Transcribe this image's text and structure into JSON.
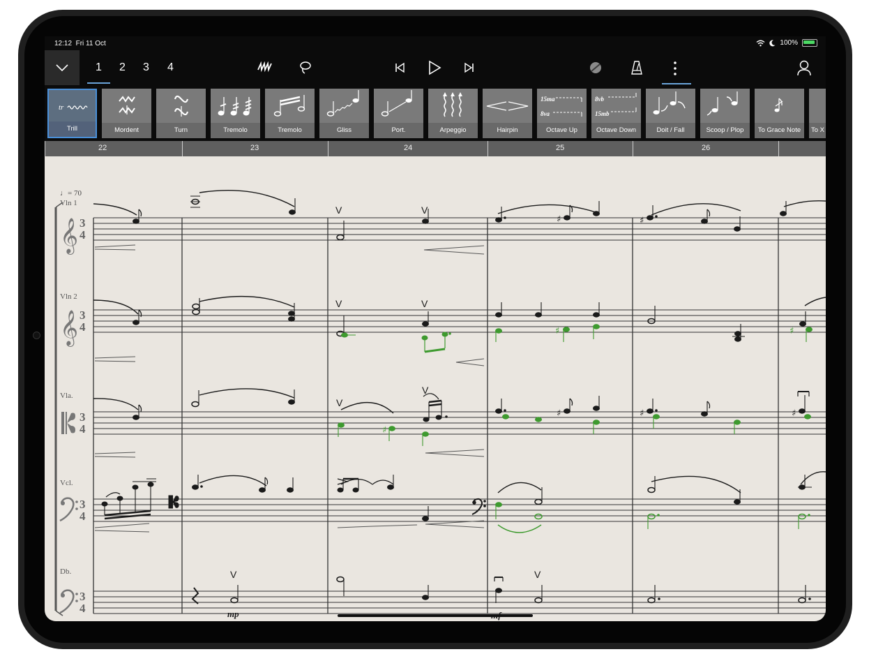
{
  "status": {
    "time": "12:12",
    "date": "Fri 11 Oct",
    "battery": "100%"
  },
  "toolbar": {
    "layouts": [
      "1",
      "2",
      "3",
      "4"
    ],
    "icons": [
      "chevron-down-icon",
      "squiggle-icon",
      "lasso-icon",
      "skip-back-icon",
      "play-icon",
      "skip-forward-icon",
      "record-disc-icon",
      "metronome-icon",
      "more-vertical-icon",
      "user-icon"
    ]
  },
  "palette": [
    "Trill",
    "Mordent",
    "Turn",
    "Tremolo",
    "Tremolo",
    "Gliss",
    "Port.",
    "Arpeggio",
    "Hairpin",
    "Octave Up",
    "Octave Down",
    "Doit / Fall",
    "Scoop / Plop",
    "To Grace Note",
    "To X"
  ],
  "palette_glyphs": {
    "trill": "tr",
    "octave_up_a": "15ma",
    "octave_up_b": "8va",
    "octave_down_a": "8vb",
    "octave_down_b": "15mb"
  },
  "bars": [
    "22",
    "23",
    "24",
    "25",
    "26"
  ],
  "score": {
    "tempo": "♩= 70",
    "meter_top": "3",
    "meter_bottom": "4",
    "instruments": [
      "Vln 1",
      "Vln 2",
      "Vla.",
      "Vcl.",
      "Db."
    ],
    "dynamics": [
      "mp",
      "mf"
    ],
    "bowing": "V",
    "colors": {
      "paper": "#eae6e0",
      "ink": "#1a1a1a",
      "green": "#3e9a2f",
      "accent": "#4a90d9"
    }
  }
}
